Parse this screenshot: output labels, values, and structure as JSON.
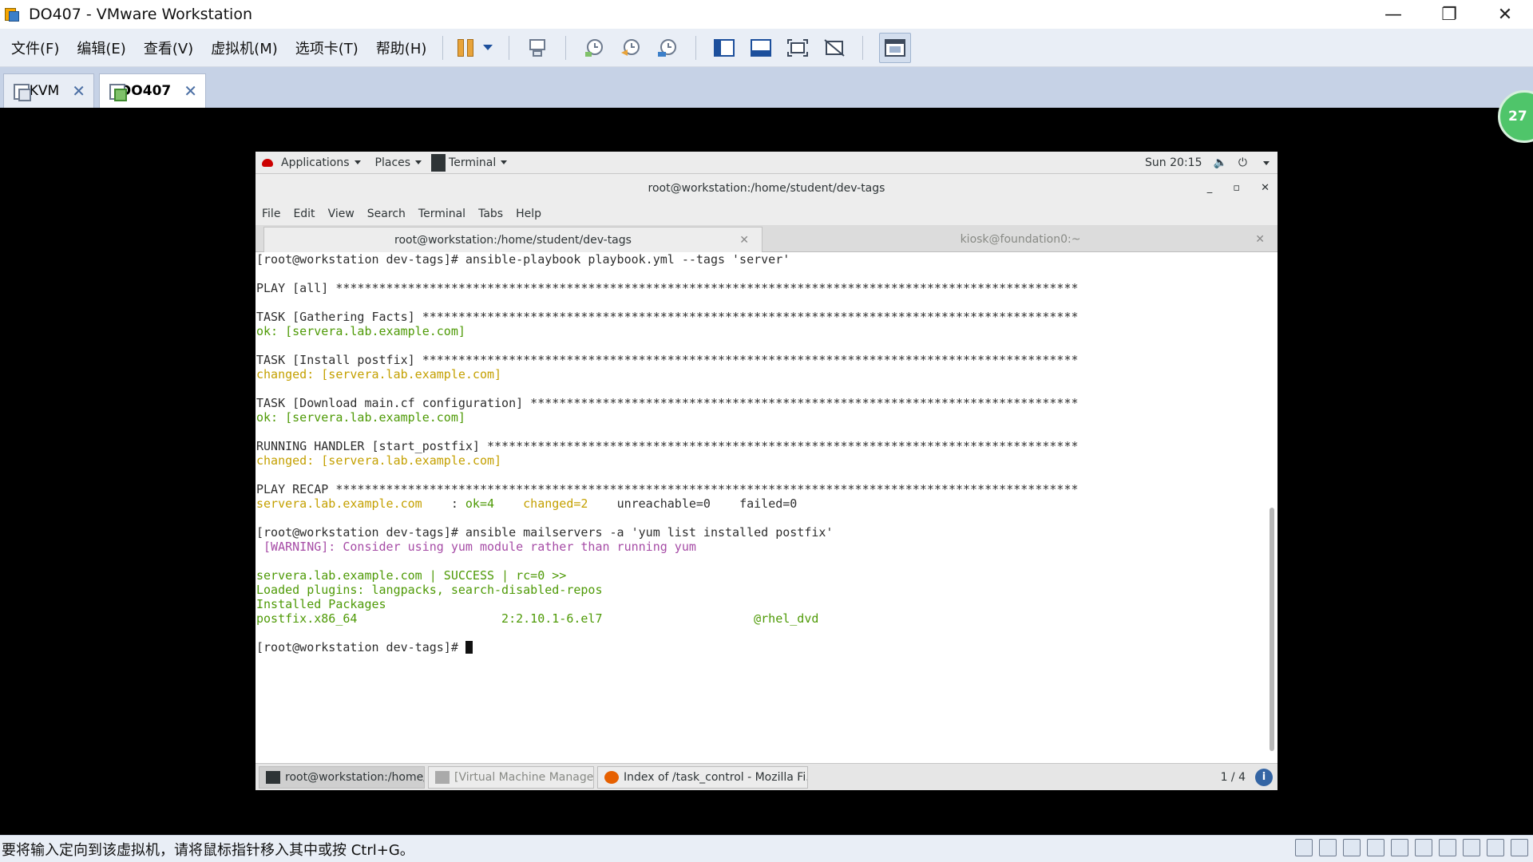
{
  "window": {
    "title": "DO407 - VMware Workstation",
    "min": "—",
    "restore": "❐",
    "close": "✕"
  },
  "vm_menu": [
    "文件(F)",
    "编辑(E)",
    "查看(V)",
    "虚拟机(M)",
    "选项卡(T)",
    "帮助(H)"
  ],
  "vm_tabs": [
    {
      "label": "KVM",
      "active": false
    },
    {
      "label": "DO407",
      "active": true
    }
  ],
  "side_badge": "27",
  "gnome": {
    "applications": "Applications",
    "places": "Places",
    "terminal": "Terminal",
    "clock": "Sun 20:15",
    "volume_icon": "🔈",
    "power_icon": "⏻"
  },
  "terminal": {
    "title": "root@workstation:/home/student/dev-tags",
    "menu": [
      "File",
      "Edit",
      "View",
      "Search",
      "Terminal",
      "Tabs",
      "Help"
    ],
    "tabs": [
      {
        "label": "root@workstation:/home/student/dev-tags",
        "active": true
      },
      {
        "label": "kiosk@foundation0:~",
        "active": false
      }
    ],
    "lines": [
      {
        "text": "[root@workstation dev-tags]# ansible-playbook playbook.yml --tags 'server'",
        "color": ""
      },
      {
        "text": "",
        "color": ""
      },
      {
        "text": "PLAY [all] *******************************************************************************************************",
        "color": ""
      },
      {
        "text": "",
        "color": ""
      },
      {
        "text": "TASK [Gathering Facts] *******************************************************************************************",
        "color": ""
      },
      {
        "text": "ok: [servera.lab.example.com]",
        "color": "green"
      },
      {
        "text": "",
        "color": ""
      },
      {
        "text": "TASK [Install postfix] *******************************************************************************************",
        "color": ""
      },
      {
        "text": "changed: [servera.lab.example.com]",
        "color": "yellow"
      },
      {
        "text": "",
        "color": ""
      },
      {
        "text": "TASK [Download main.cf configuration] ****************************************************************************",
        "color": ""
      },
      {
        "text": "ok: [servera.lab.example.com]",
        "color": "green"
      },
      {
        "text": "",
        "color": ""
      },
      {
        "text": "RUNNING HANDLER [start_postfix] **********************************************************************************",
        "color": ""
      },
      {
        "text": "changed: [servera.lab.example.com]",
        "color": "yellow"
      },
      {
        "text": "",
        "color": ""
      },
      {
        "text": "PLAY RECAP *******************************************************************************************************",
        "color": ""
      },
      {
        "text": "__RECAP__",
        "color": ""
      },
      {
        "text": "",
        "color": ""
      },
      {
        "text": "[root@workstation dev-tags]# ansible mailservers -a 'yum list installed postfix'",
        "color": ""
      },
      {
        "text": " [WARNING]: Consider using yum module rather than running yum",
        "color": "magenta"
      },
      {
        "text": "",
        "color": ""
      },
      {
        "text": "servera.lab.example.com | SUCCESS | rc=0 >>",
        "color": "green"
      },
      {
        "text": "Loaded plugins: langpacks, search-disabled-repos",
        "color": "green"
      },
      {
        "text": "Installed Packages",
        "color": "green"
      },
      {
        "text": "postfix.x86_64                    2:2.10.1-6.el7                     @rhel_dvd",
        "color": "green"
      },
      {
        "text": "",
        "color": ""
      },
      {
        "text": "__PROMPT__",
        "color": ""
      }
    ],
    "recap": {
      "host": "servera.lab.example.com    ",
      "sep": ": ",
      "ok": "ok=4",
      "changed": "changed=2",
      "unreachable": "unreachable=0",
      "failed": "failed=0"
    },
    "prompt": "[root@workstation dev-tags]# "
  },
  "taskbar": {
    "items": [
      {
        "label": "root@workstation:/home/student...",
        "icon": "terminal-icon",
        "active": true
      },
      {
        "label": "[Virtual Machine Manager]",
        "icon": "vmm-icon",
        "active": false
      },
      {
        "label": "Index of /task_control - Mozilla Fi...",
        "icon": "firefox-icon",
        "active": false
      }
    ],
    "workspace": "1 / 4",
    "info": "i"
  },
  "status_bar": {
    "text": "要将输入定向到该虚拟机，请将鼠标指针移入其中或按 Ctrl+G。"
  }
}
